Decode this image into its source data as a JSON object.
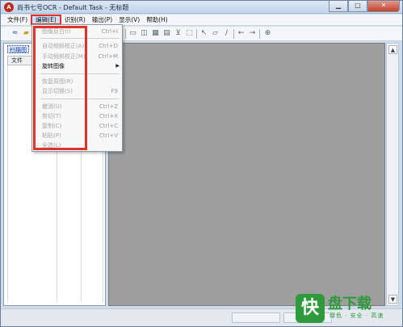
{
  "window": {
    "title": "尚书七号OCR - Default Task - 无标题",
    "app_icon_glyph": "A",
    "controls": {
      "minimize": "▁",
      "maximize": "□",
      "close": "✕"
    }
  },
  "menubar": {
    "items": [
      {
        "label": "文件(F)"
      },
      {
        "label": "编辑(E)"
      },
      {
        "label": "识别(R)"
      },
      {
        "label": "输出(P)"
      },
      {
        "label": "显示(V)"
      },
      {
        "label": "帮助(H)"
      }
    ]
  },
  "edit_menu": {
    "items": [
      {
        "label": "图像反白(I)",
        "shortcut": "Ctrl+I",
        "enabled": false
      },
      {
        "label": "自动倾斜校正(A)",
        "shortcut": "Ctrl+D",
        "enabled": false
      },
      {
        "label": "手动倾斜校正(M)",
        "shortcut": "Ctrl+M",
        "enabled": false
      },
      {
        "label": "旋转图像",
        "shortcut": "",
        "enabled": true,
        "submenu": true
      },
      {
        "label": "恢复原图(R)",
        "shortcut": "",
        "enabled": false
      },
      {
        "label": "显示切换(S)",
        "shortcut": "F9",
        "enabled": false
      },
      {
        "label": "撤消(U)",
        "shortcut": "Ctrl+Z",
        "enabled": false
      },
      {
        "label": "剪切(T)",
        "shortcut": "Ctrl+X",
        "enabled": false
      },
      {
        "label": "复制(C)",
        "shortcut": "Ctrl+C",
        "enabled": false
      },
      {
        "label": "粘贴(P)",
        "shortcut": "Ctrl+V",
        "enabled": false
      },
      {
        "label": "全选(L)",
        "shortcut": "",
        "enabled": false
      }
    ]
  },
  "left_panel": {
    "tab": "扫描图",
    "column_header": "文件"
  },
  "logo": {
    "mark": "快",
    "name": "盘下载",
    "tagline": "绿色 · 安全 · 高速"
  },
  "colors": {
    "highlight": "#e0322b",
    "workspace": "#9e9e9e",
    "logo_green": "#2f9a3c"
  }
}
